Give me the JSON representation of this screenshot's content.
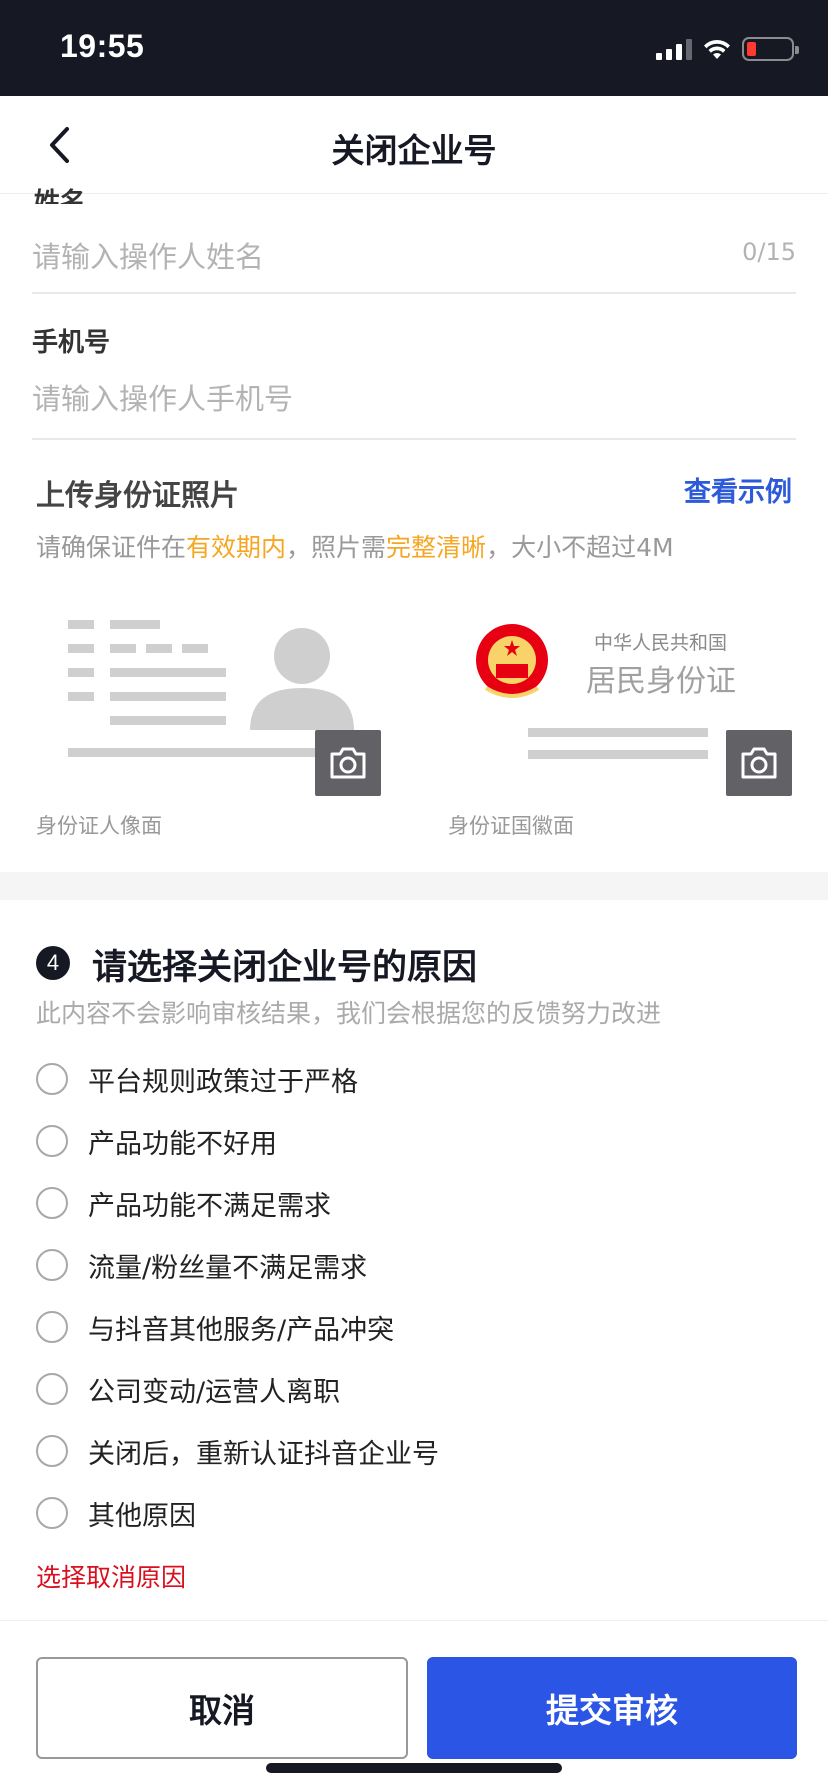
{
  "status_bar": {
    "time": "19:55",
    "battery_color": "#ff3b30"
  },
  "nav": {
    "title": "关闭企业号",
    "back_icon": "chevron-left-icon"
  },
  "form": {
    "name_label": "姓名",
    "name_placeholder": "请输入操作人姓名",
    "name_counter": "0/15",
    "phone_label": "手机号",
    "phone_placeholder": "请输入操作人手机号"
  },
  "upload": {
    "title": "上传身份证照片",
    "example_link": "查看示例",
    "hint_prefix": "请确保证件在",
    "hint_valid": "有效期内",
    "hint_middle": "，照片需",
    "hint_clear": "完整清晰",
    "hint_suffix": "，大小不超过4M",
    "front_caption": "身份证人像面",
    "back_caption": "身份证国徽面",
    "back_card_country": "中华人民共和国",
    "back_card_title": "居民身份证"
  },
  "reasons_section": {
    "step": "4",
    "title": "请选择关闭企业号的原因",
    "subtitle": "此内容不会影响审核结果，我们会根据您的反馈努力改进",
    "options": [
      "平台规则政策过于严格",
      "产品功能不好用",
      "产品功能不满足需求",
      "流量/粉丝量不满足需求",
      "与抖音其他服务/产品冲突",
      "公司变动/运营人离职",
      "关闭后，重新认证抖音企业号",
      "其他原因"
    ],
    "error": "选择取消原因"
  },
  "actions": {
    "cancel": "取消",
    "submit": "提交审核"
  },
  "colors": {
    "accent": "#2a55e5",
    "link": "#2c5ad8",
    "warning": "#f5a623",
    "error": "#d80f1e"
  }
}
